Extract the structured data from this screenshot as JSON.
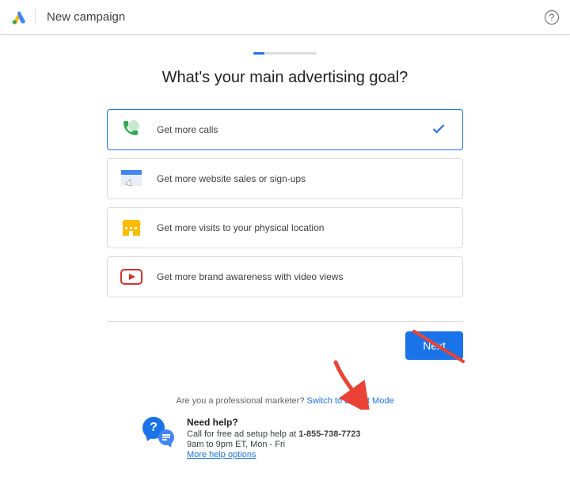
{
  "header": {
    "title": "New campaign"
  },
  "question": "What's your main advertising goal?",
  "options": {
    "calls": {
      "label": "Get more calls",
      "selected": true
    },
    "website": {
      "label": "Get more website sales or sign-ups",
      "selected": false
    },
    "visits": {
      "label": "Get more visits to your physical location",
      "selected": false
    },
    "video": {
      "label": "Get more brand awareness with video views",
      "selected": false
    }
  },
  "next_label": "Next",
  "promo": {
    "question": "Are you a professional marketer? ",
    "link": "Switch to Expert Mode"
  },
  "help": {
    "title": "Need help?",
    "line1_pre": "Call for free ad setup help at ",
    "phone": "1-855-738-7723",
    "line2": "9am to 9pm ET, Mon - Fri",
    "link": "More help options"
  },
  "annotation": {
    "arrow_color": "#ea4335",
    "strike_color": "#ea4335"
  }
}
